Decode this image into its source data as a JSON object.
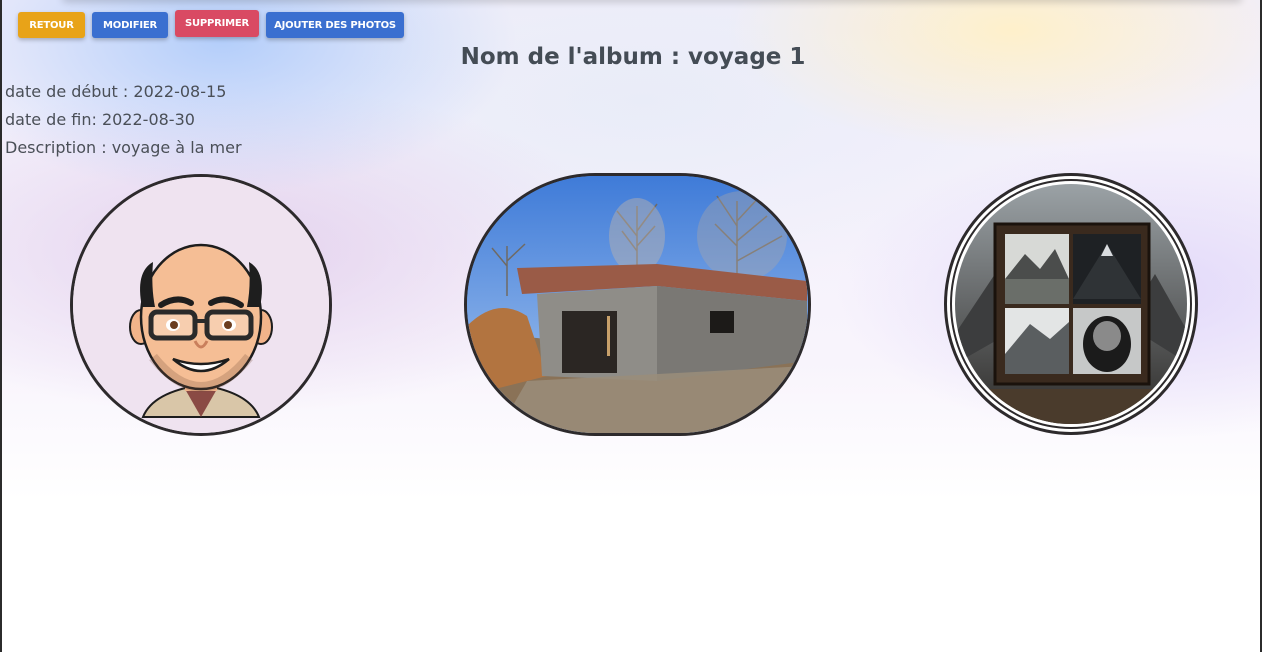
{
  "toolbar": {
    "back_label": "RETOUR",
    "edit_label": "MODIFIER",
    "delete_label": "SUPPRIMER",
    "add_photos_label": "AJOUTER DES PHOTOS"
  },
  "album": {
    "title": "Nom de l'album : voyage 1",
    "start_date": "date de début : 2022-08-15",
    "end_date": "date de fin: 2022-08-30",
    "description": "Description : voyage à la mer"
  },
  "photos": [
    {
      "subject": "cartoon avatar"
    },
    {
      "subject": "house construction"
    },
    {
      "subject": "framed mountain collage"
    }
  ],
  "colors": {
    "retour": "#e8a318",
    "primary": "#3a6fd0",
    "danger": "#d94a63",
    "text": "#444c55"
  }
}
